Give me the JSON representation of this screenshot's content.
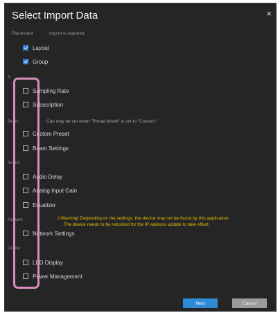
{
  "dialog": {
    "title": "Select Import Data",
    "close_symbol": "×",
    "placement_label": "Placement",
    "import_required": "Import is required.",
    "placement_items": [
      {
        "label": "Layout",
        "checked": true
      },
      {
        "label": "Group",
        "checked": true
      }
    ],
    "items": [
      {
        "label": "Sampling Rate",
        "checked": false
      },
      {
        "label": "Subscription",
        "checked": false
      },
      {
        "label": "Custom Preset",
        "checked": false
      },
      {
        "label": "Beam Settings",
        "checked": false
      },
      {
        "label": "Audio Delay",
        "checked": false
      },
      {
        "label": "Analog Input Gain",
        "checked": false
      },
      {
        "label": "Equalizer",
        "checked": false
      },
      {
        "label": "Network Settings",
        "checked": false
      },
      {
        "label": "LED Display",
        "checked": false
      },
      {
        "label": "Power Management",
        "checked": false
      }
    ],
    "sections": {
      "s1": "S",
      "beam": "Beam",
      "sound": "Sound",
      "network": "Network",
      "device": "Device"
    },
    "custom_note": "Can only be set when \"Preset Mode\" is set to \"Custom.\"",
    "warning_line1": "⚠Warning! Depending on the settings, the device may not be found by this application.",
    "warning_line2": "The device needs to be rebooted for the IP address update to take effect.",
    "next_label": "Next",
    "cancel_label": "Cancel"
  },
  "colors": {
    "background": "#252526",
    "accent": "#2f8ad6",
    "warning": "#e6c200",
    "highlight": "#d88fbd"
  }
}
